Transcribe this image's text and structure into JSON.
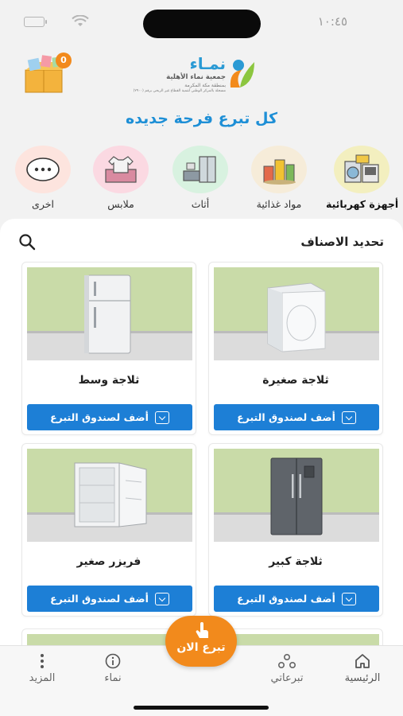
{
  "status_bar": {
    "time": "١٠:٤٥"
  },
  "header": {
    "logo": {
      "name": "نمـاء",
      "line1": "جمعية نماء الأهلية",
      "line2": "بمنطقة مكة المكرمة",
      "line3": "مسجلة بالمركز الوطني لتنمية القطاع غير الربحي برقم (٢٩٠٠)"
    },
    "cart_count": "0",
    "tagline": "كل تبرع فرحة جديده"
  },
  "categories": [
    {
      "label": "أجهزة كهربائية",
      "icon": "appliances-icon",
      "bg": "#f3efbf",
      "active": true
    },
    {
      "label": "مواد غذائية",
      "icon": "groceries-icon",
      "bg": "#f6ecd9",
      "active": false
    },
    {
      "label": "أثاث",
      "icon": "furniture-icon",
      "bg": "#d8f2e0",
      "active": false
    },
    {
      "label": "ملابس",
      "icon": "clothes-icon",
      "bg": "#fbd9e2",
      "active": false
    },
    {
      "label": "اخرى",
      "icon": "more-icon",
      "bg": "#fde4de",
      "active": false
    }
  ],
  "main": {
    "title": "تحديد الاصناف",
    "products": [
      {
        "name": "ثلاجة صغيرة",
        "button": "أضف لصندوق التبرع",
        "image": "small-fridge"
      },
      {
        "name": "ثلاجة وسط",
        "button": "أضف لصندوق التبرع",
        "image": "medium-fridge"
      },
      {
        "name": "ثلاجة كبير",
        "button": "أضف لصندوق التبرع",
        "image": "large-fridge"
      },
      {
        "name": "فريزر صغير",
        "button": "أضف لصندوق التبرع",
        "image": "small-freezer"
      }
    ]
  },
  "bottom_nav": {
    "home": "الرئيسية",
    "my_donations": "تبرعاتي",
    "donate_now": "تبرع الان",
    "namaa": "نماء",
    "more": "المزيد"
  },
  "colors": {
    "primary_blue": "#1d7fd6",
    "accent_orange": "#f28a1c",
    "tagline_blue": "#1e8fd6"
  }
}
